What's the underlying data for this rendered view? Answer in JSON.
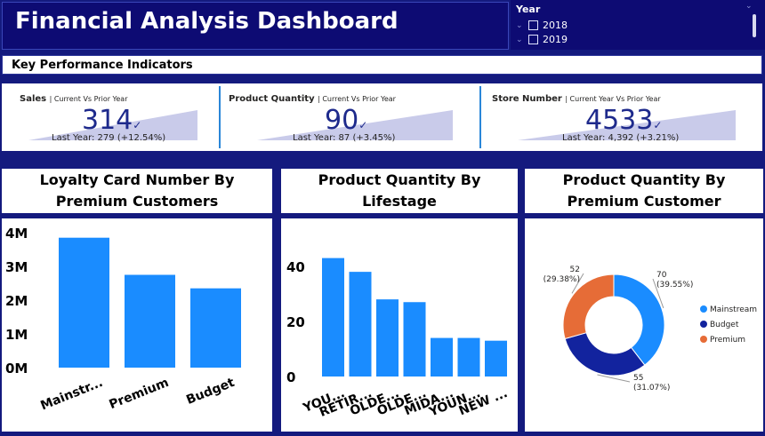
{
  "header": {
    "title": "Financial Analysis Dashboard"
  },
  "slicer": {
    "label": "Year",
    "options": [
      {
        "label": "2018",
        "checked": false
      },
      {
        "label": "2019",
        "checked": false
      }
    ]
  },
  "kpi_section": {
    "title": "Key Performance Indicators",
    "cards": [
      {
        "title": "Sales",
        "subtitle": "| Current Vs Prior Year",
        "value": "314",
        "last_year": "Last Year: 279 (+12.54%)"
      },
      {
        "title": "Product Quantity",
        "subtitle": "| Current Vs Prior Year",
        "value": "90",
        "last_year": "Last Year: 87 (+3.45%)"
      },
      {
        "title": "Store Number",
        "subtitle": "| Current Year Vs Prior Year",
        "value": "4533",
        "last_year": "Last Year: 4,392 (+3.21%)"
      }
    ]
  },
  "colors": {
    "bar": "#1a8cff",
    "mainstream": "#1a8cff",
    "budget": "#12239e",
    "premium": "#e66c37",
    "kpi_accent": "#1e2a8c",
    "trend_fill": "#c9cbea"
  },
  "chart_data": [
    {
      "type": "bar",
      "title": "Loyalty Card Number By Premium Customers",
      "categories": [
        "Mainstr...",
        "Premium",
        "Budget"
      ],
      "values": [
        3850000,
        2750000,
        2350000
      ],
      "ylim": [
        0,
        4000000
      ],
      "yticks": [
        "0M",
        "1M",
        "2M",
        "3M",
        "4M"
      ]
    },
    {
      "type": "bar",
      "title": "Product Quantity By Lifestage",
      "categories": [
        "YOU...",
        "RETIR...",
        "OLDE...",
        "OLDE...",
        "MIDA...",
        "YOUN...",
        "NEW ..."
      ],
      "values": [
        43,
        38,
        28,
        27,
        14,
        14,
        13
      ],
      "ylim": [
        0,
        49
      ],
      "yticks": [
        "0",
        "20",
        "40"
      ]
    },
    {
      "type": "pie",
      "title": "Product Quantity By Premium Customer",
      "categories": [
        "Mainstream",
        "Budget",
        "Premium"
      ],
      "values": [
        70,
        55,
        52
      ],
      "labels": [
        {
          "value": "70",
          "pct": "(39.55%)"
        },
        {
          "value": "55",
          "pct": "(31.07%)"
        },
        {
          "value": "52",
          "pct": "(29.38%)"
        }
      ],
      "legend": "right"
    }
  ]
}
